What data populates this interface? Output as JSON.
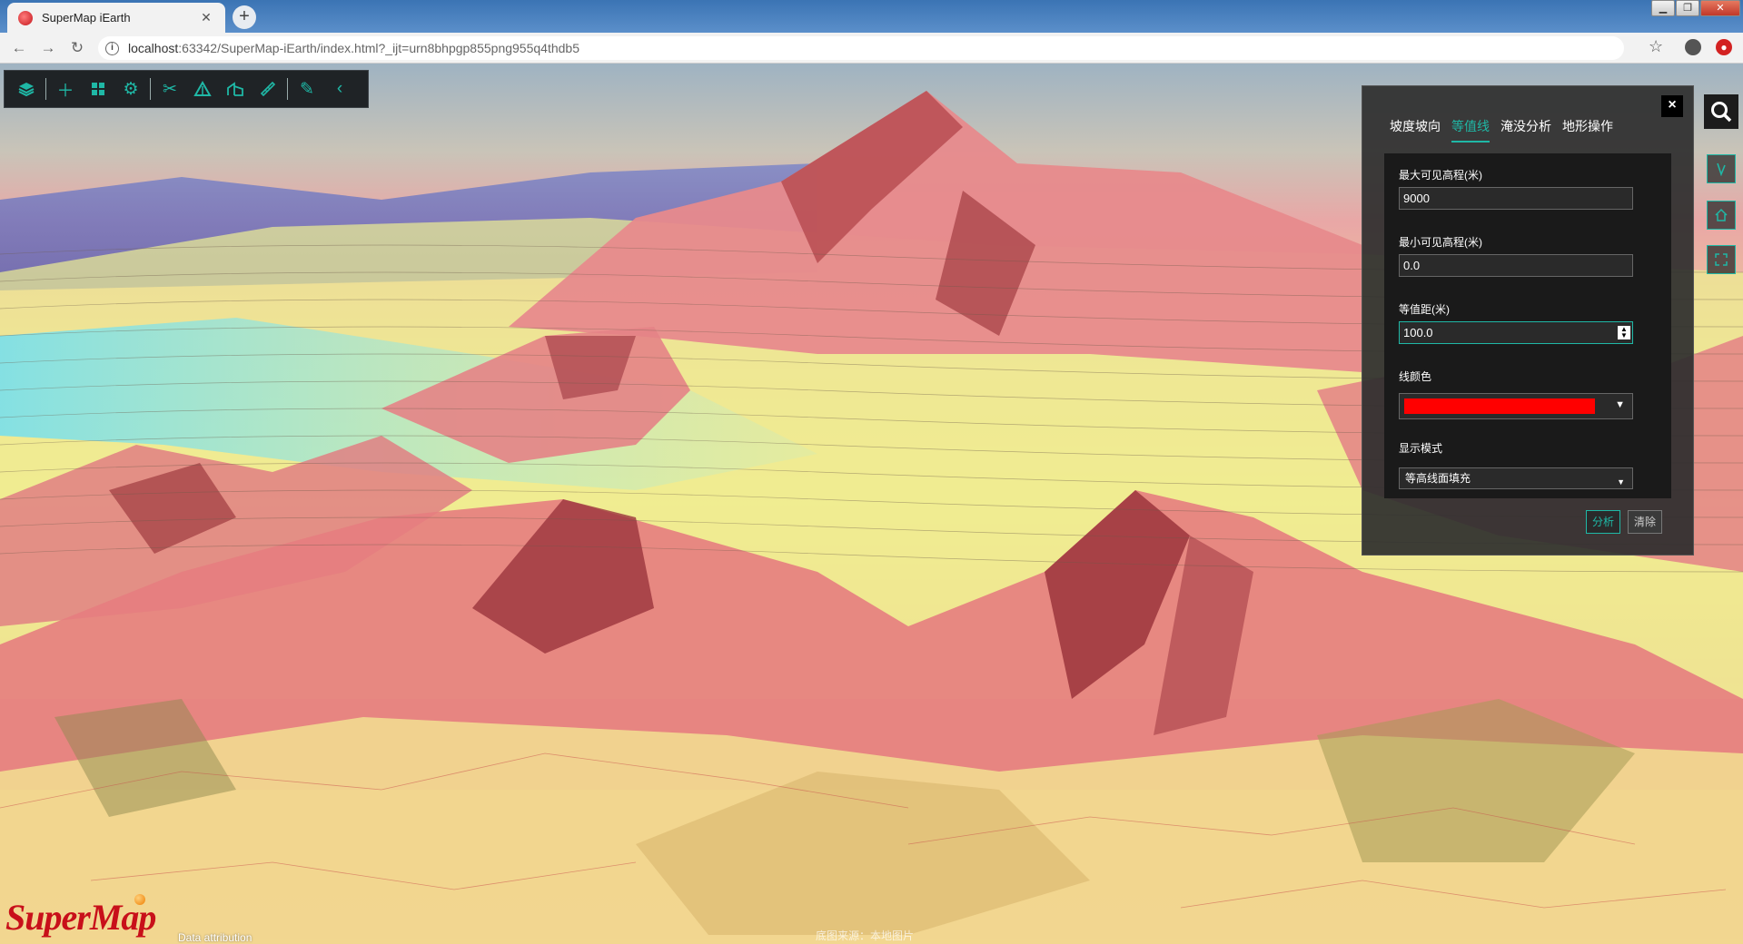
{
  "browser": {
    "tab_title": "SuperMap iEarth",
    "tab_ghost": "SuperMap iEarth",
    "url_host": "localhost",
    "url_rest": ":63342/SuperMap-iEarth/index.html?_ijt=urn8bhpgp855png955q4thdb5",
    "window_controls": [
      "minimize",
      "restore",
      "close"
    ]
  },
  "toolbar": {
    "icons": [
      "layers-icon",
      "plus-icon",
      "grid-icon",
      "gear-icon",
      "scissors-icon",
      "terrain-icon",
      "building-icon",
      "ruler-icon",
      "pen-icon",
      "chevron-left-icon"
    ]
  },
  "panel": {
    "tabs": [
      "坡度坡向",
      "等值线",
      "淹没分析",
      "地形操作"
    ],
    "active_tab": "等值线",
    "max_label": "最大可见高程(米)",
    "max_value": "9000",
    "min_label": "最小可见高程(米)",
    "min_value": "0.0",
    "interval_label": "等值距(米)",
    "interval_value": "100.0",
    "color_label": "线颜色",
    "line_color": "#ff0000",
    "mode_label": "显示模式",
    "mode_value": "等高线面填充",
    "analyze_label": "分析",
    "clear_label": "清除"
  },
  "footer": {
    "logo": "SuperMap",
    "attribution": "Data attribution",
    "source": "底图来源：本地图片"
  },
  "colors": {
    "accent": "#1fb8a6",
    "brand_red": "#c8101a"
  }
}
